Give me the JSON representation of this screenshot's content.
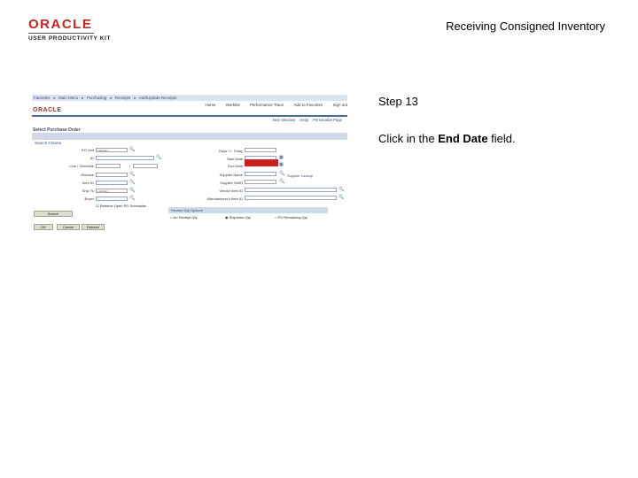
{
  "branding": {
    "logo_word": "ORACLE",
    "logo_subtitle": "USER PRODUCTIVITY KIT",
    "brand_color": "#c8241c"
  },
  "document": {
    "title": "Receiving Consigned Inventory"
  },
  "step": {
    "label": "Step 13",
    "instruction_prefix": "Click in the ",
    "instruction_target": "End Date",
    "instruction_suffix": " field."
  },
  "screenshot": {
    "breadcrumbs": [
      "Favorites",
      "Main Menu",
      "Purchasing",
      "Receipts",
      "Add/Update Receipts"
    ],
    "top_nav": [
      "Home",
      "Worklist",
      "Performance Trace",
      "Add to Favorites",
      "Sign out"
    ],
    "app_logo": "ORACLE",
    "header_links": [
      "New Window",
      "Help",
      "Personalize Page"
    ],
    "page_title": "Select Purchase Order",
    "section_title": "Search Criteria",
    "left_fields": [
      {
        "label": "PO Unit",
        "value": "US001"
      },
      {
        "label": "ID",
        "value": ""
      },
      {
        "label": "Line / Schedule",
        "value": ""
      },
      {
        "label": "Release",
        "value": ""
      },
      {
        "label": "Item ID",
        "value": ""
      },
      {
        "label": "Ship To",
        "value": "US001"
      },
      {
        "label": "Buyer",
        "value": ""
      }
    ],
    "right_fields": [
      {
        "label": "Days +/- Today",
        "value": ""
      },
      {
        "label": "Start Date",
        "value": ""
      },
      {
        "label": "End Date",
        "value": ""
      },
      {
        "label": "Supplier Name",
        "value": ""
      },
      {
        "label": "Supplier SetID",
        "value": ""
      },
      {
        "label": "Vendor Item ID",
        "value": ""
      },
      {
        "label": "Manufacturer's Item ID",
        "value": ""
      }
    ],
    "supplier_link": "Supplier Lookup",
    "retrieve_checkbox": "Retrieve Open PO Schedules",
    "search_button": "Search",
    "po_qty_title": "Receipt Qty Options",
    "radios": [
      "No Receipt Qty",
      "Shipment Qty",
      "PO Remaining Qty"
    ],
    "footer_buttons": [
      "OK",
      "Cancel",
      "Refresh"
    ]
  },
  "colors": {
    "highlight": "#d42020",
    "nav_blue": "#3a4b78",
    "section_bg": "#cfd9ea"
  }
}
